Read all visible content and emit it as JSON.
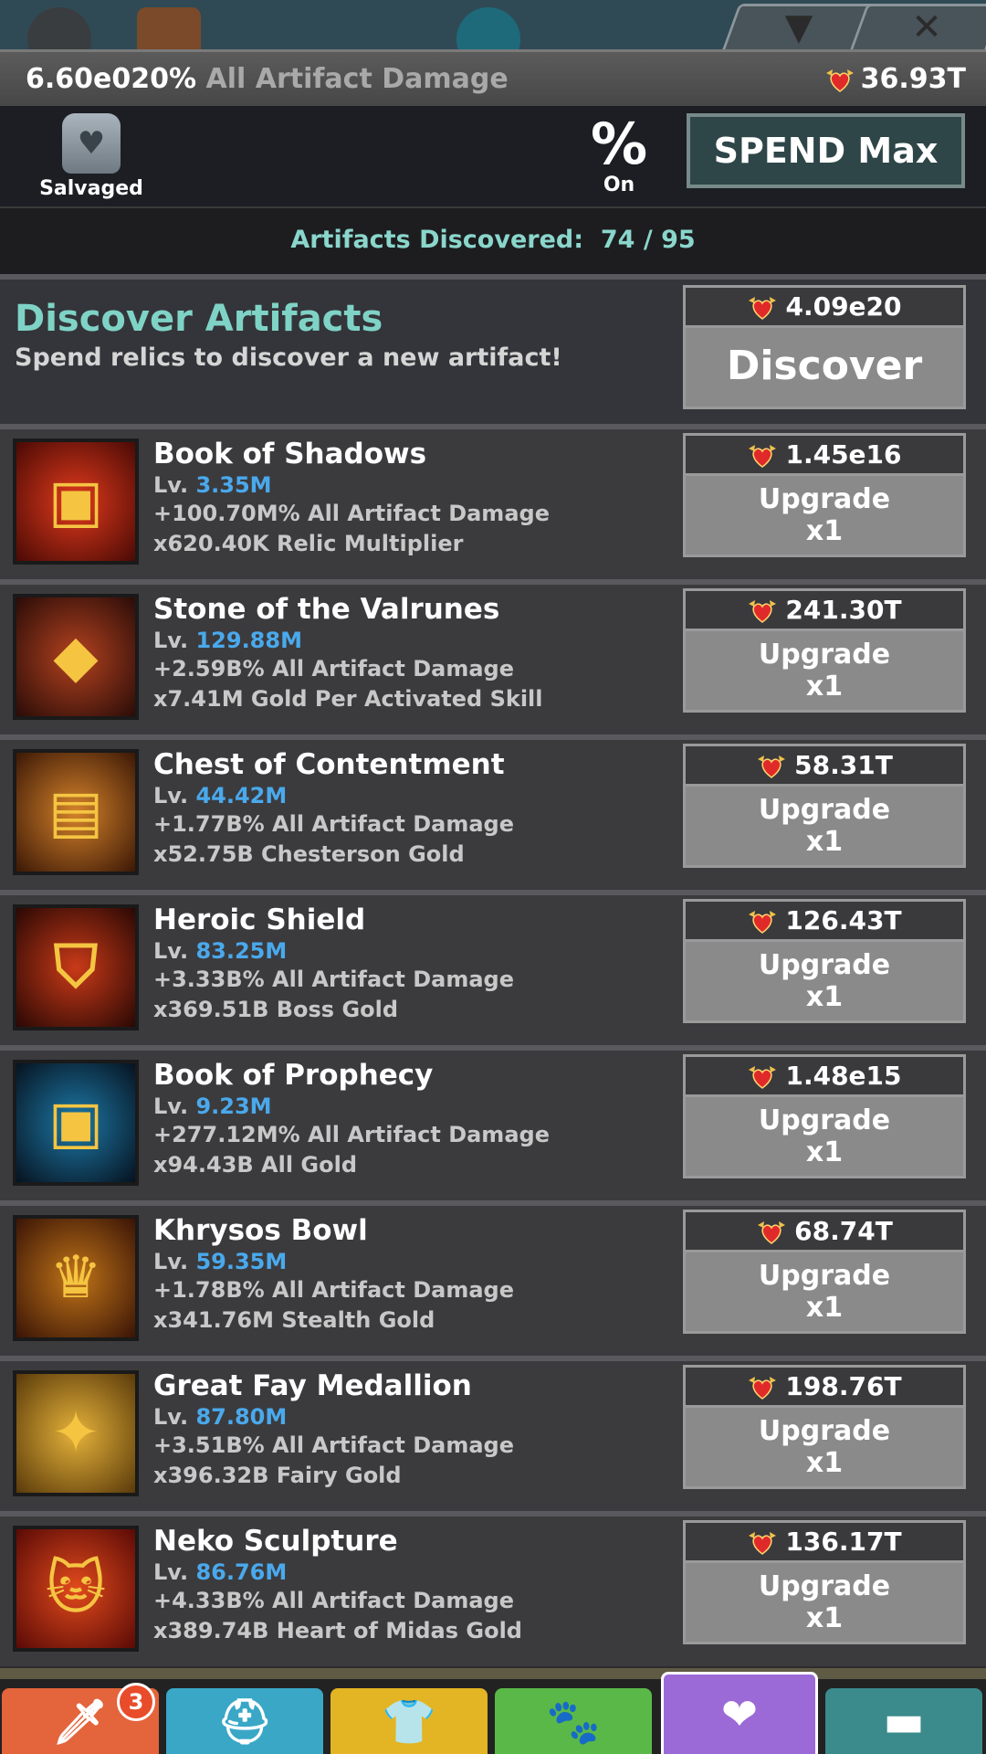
{
  "header": {
    "damage_value": "6.60e020%",
    "damage_label": "All Artifact Damage",
    "relic_total": "36.93T"
  },
  "subheader": {
    "salvaged_label": "Salvaged",
    "percent_symbol": "%",
    "percent_state": "On",
    "spend_label": "SPEND Max"
  },
  "discovered": {
    "label": "Artifacts Discovered:",
    "count": "74 / 95"
  },
  "discover": {
    "title": "Discover Artifacts",
    "subtitle": "Spend relics to discover a new artifact!",
    "cost": "4.09e20",
    "button_label": "Discover"
  },
  "artifacts": [
    {
      "name": "Book of Shadows",
      "level": "3.35M",
      "stat1": "+100.70M% All Artifact Damage",
      "stat2": "x620.40K Relic Multiplier",
      "cost": "1.45e16",
      "action": "Upgrade",
      "mult": "x1",
      "icon": "dark-book-icon"
    },
    {
      "name": "Stone of the Valrunes",
      "level": "129.88M",
      "stat1": "+2.59B% All Artifact Damage",
      "stat2": "x7.41M Gold Per Activated Skill",
      "cost": "241.30T",
      "action": "Upgrade",
      "mult": "x1",
      "icon": "red-gem-pendant-icon"
    },
    {
      "name": "Chest of Contentment",
      "level": "44.42M",
      "stat1": "+1.77B% All Artifact Damage",
      "stat2": "x52.75B Chesterson Gold",
      "cost": "58.31T",
      "action": "Upgrade",
      "mult": "x1",
      "icon": "gold-chest-icon"
    },
    {
      "name": "Heroic Shield",
      "level": "83.25M",
      "stat1": "+3.33B% All Artifact Damage",
      "stat2": "x369.51B Boss Gold",
      "cost": "126.43T",
      "action": "Upgrade",
      "mult": "x1",
      "icon": "shield-icon"
    },
    {
      "name": "Book of Prophecy",
      "level": "9.23M",
      "stat1": "+277.12M% All Artifact Damage",
      "stat2": "x94.43B All Gold",
      "cost": "1.48e15",
      "action": "Upgrade",
      "mult": "x1",
      "icon": "blue-book-icon"
    },
    {
      "name": "Khrysos Bowl",
      "level": "59.35M",
      "stat1": "+1.78B% All Artifact Damage",
      "stat2": "x341.76M Stealth Gold",
      "cost": "68.74T",
      "action": "Upgrade",
      "mult": "x1",
      "icon": "gold-bowl-icon"
    },
    {
      "name": "Great Fay Medallion",
      "level": "87.80M",
      "stat1": "+3.51B% All Artifact Damage",
      "stat2": "x396.32B Fairy Gold",
      "cost": "198.76T",
      "action": "Upgrade",
      "mult": "x1",
      "icon": "winged-medallion-icon"
    },
    {
      "name": "Neko Sculpture",
      "level": "86.76M",
      "stat1": "+4.33B% All Artifact Damage",
      "stat2": "x389.74B Heart of Midas Gold",
      "cost": "136.17T",
      "action": "Upgrade",
      "mult": "x1",
      "icon": "cat-sculpture-icon"
    }
  ],
  "labels": {
    "lv_prefix": "Lv."
  },
  "nav": {
    "tabs": [
      {
        "icon": "sword-icon",
        "color": "#e4643c"
      },
      {
        "icon": "viking-helmet-icon",
        "color": "#3aa7c7"
      },
      {
        "icon": "tunic-icon",
        "color": "#e3b423"
      },
      {
        "icon": "pet-icon",
        "color": "#5ab848"
      },
      {
        "icon": "relic-heart-icon",
        "color": "#9b6ad6"
      },
      {
        "icon": "chest-icon",
        "color": "#3b8a8c"
      }
    ],
    "sword_badge": "3"
  },
  "colors": {
    "accent_teal": "#7fd3c6",
    "level_blue": "#4aa9ec",
    "button_gray": "#8a8a8a"
  }
}
